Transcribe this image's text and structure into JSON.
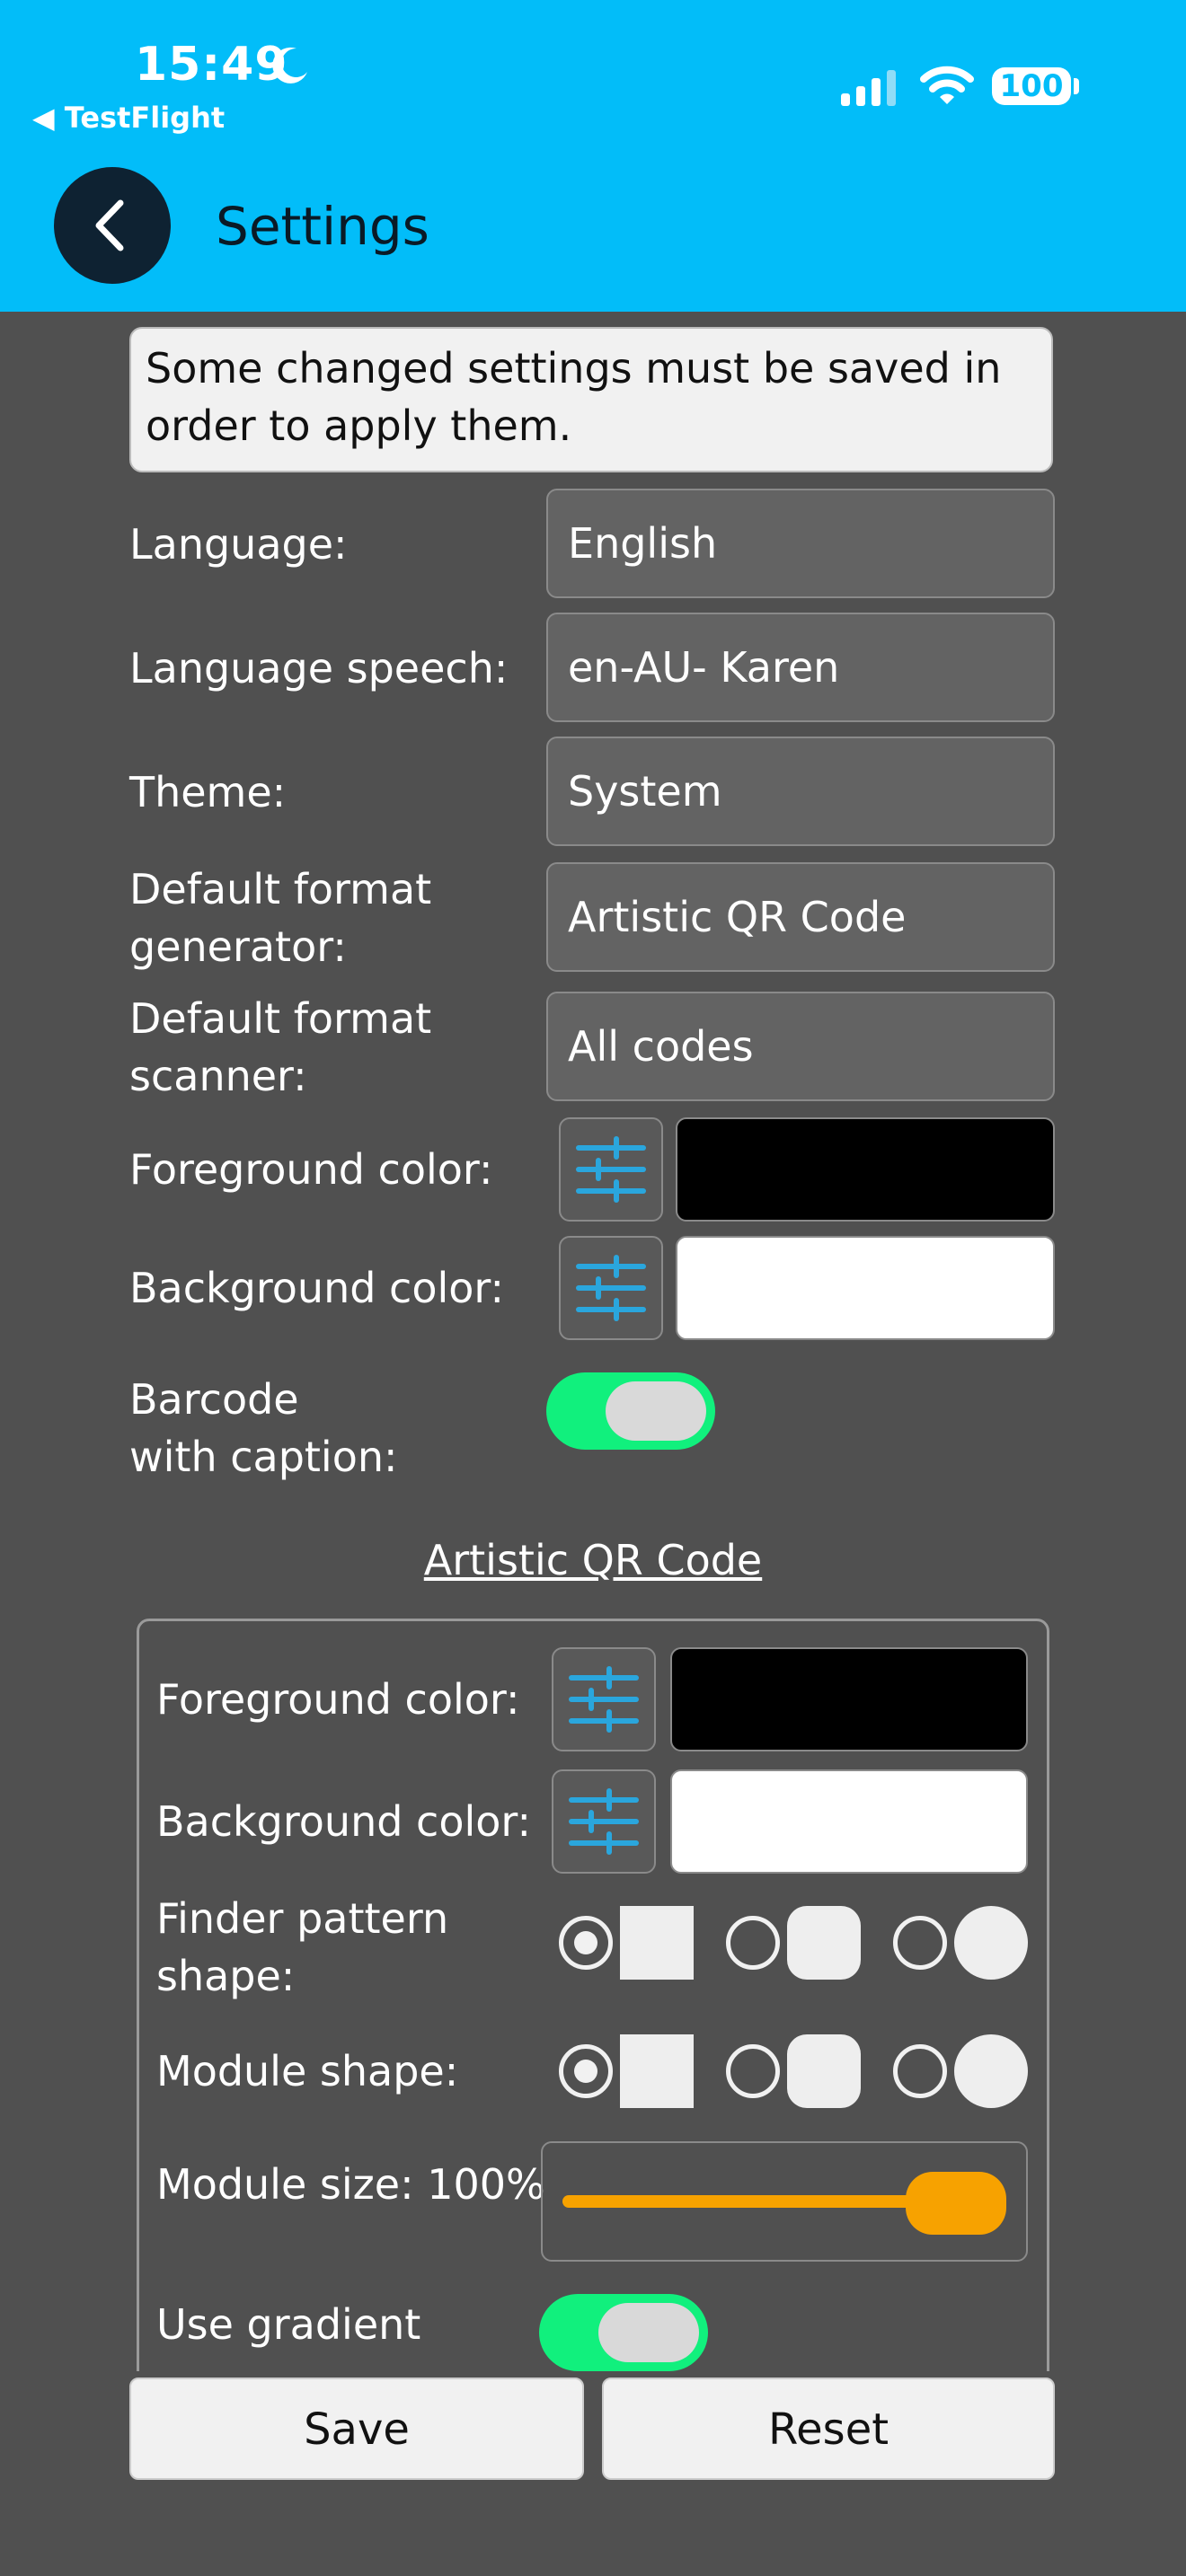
{
  "status_bar": {
    "time": "15:49",
    "back_app": "◀ TestFlight",
    "battery": "100"
  },
  "header": {
    "title": "Settings"
  },
  "notice": "Some changed settings must be saved in order to apply them.",
  "general": {
    "language_label": "Language:",
    "language_value": "English",
    "speech_label": "Language speech:",
    "speech_value": "en-AU- Karen",
    "theme_label": "Theme:",
    "theme_value": "System",
    "generator_label_1": "Default format",
    "generator_label_2": "generator:",
    "generator_value": "Artistic QR Code",
    "scanner_label_1": "Default format",
    "scanner_label_2": "scanner:",
    "scanner_value": "All codes",
    "fg_label": "Foreground color:",
    "fg_color": "#000000",
    "bg_label": "Background color:",
    "bg_color": "#ffffff",
    "caption_label_1": "Barcode",
    "caption_label_2": "with caption:",
    "caption_on": true
  },
  "artistic": {
    "section_title": "Artistic QR Code",
    "fg_label": "Foreground color:",
    "fg_color": "#000000",
    "bg_label": "Background color:",
    "bg_color": "#ffffff",
    "finder_label_1": "Finder pattern",
    "finder_label_2": "shape:",
    "finder_selected": "square",
    "module_label": "Module shape:",
    "module_selected": "square",
    "module_size_label": "Module size: 100%",
    "module_size_value": 100,
    "gradient_label": "Use gradient",
    "gradient_on": true
  },
  "buttons": {
    "save": "Save",
    "reset": "Reset"
  },
  "colors": {
    "header": "#02BDF9",
    "toggle_on": "#11F07D",
    "accent": "#F7A200",
    "icon_blue": "#2aa6dd"
  }
}
